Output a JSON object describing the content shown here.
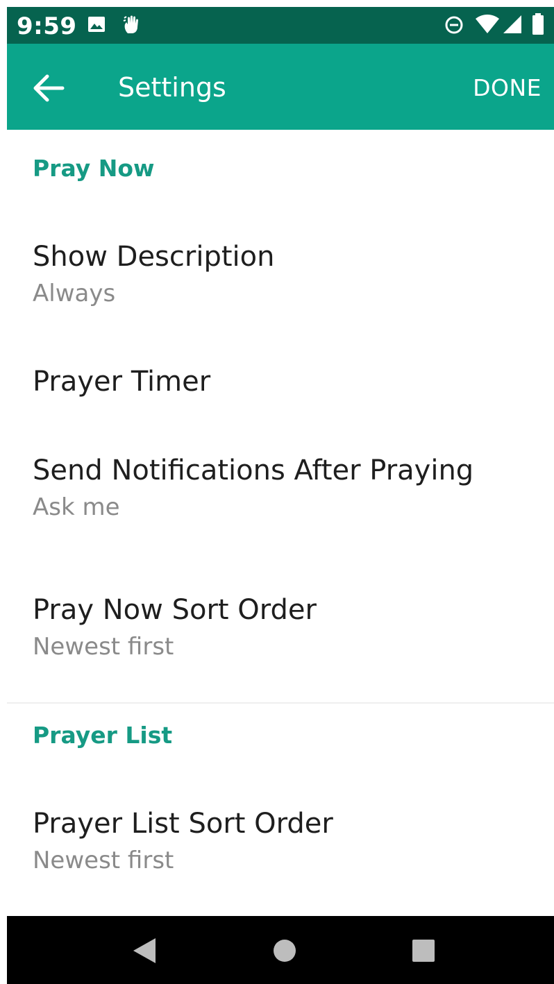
{
  "status_bar": {
    "time": "9:59",
    "icons": [
      "image-icon",
      "hand-icon",
      "do-not-disturb-icon",
      "wifi-icon",
      "signal-icon",
      "battery-icon"
    ]
  },
  "app_bar": {
    "title": "Settings",
    "done_label": "DONE",
    "back_icon": "arrow-back-icon"
  },
  "sections": [
    {
      "header": "Pray Now",
      "items": [
        {
          "title": "Show Description",
          "summary": "Always"
        },
        {
          "title": "Prayer Timer",
          "summary": ""
        },
        {
          "title": "Send Notifications After Praying",
          "summary": "Ask me"
        },
        {
          "title": "Pray Now Sort Order",
          "summary": "Newest first"
        }
      ]
    },
    {
      "header": "Prayer List",
      "items": [
        {
          "title": "Prayer List Sort Order",
          "summary": "Newest first"
        }
      ]
    }
  ],
  "nav_bar": {
    "icons": [
      "back-triangle-icon",
      "home-circle-icon",
      "recents-square-icon"
    ]
  },
  "colors": {
    "status_bar": "#06634f",
    "app_bar": "#0ba58b",
    "accent": "#169a84",
    "text_primary": "#1e1e1e",
    "text_secondary": "#8a8a8a"
  }
}
